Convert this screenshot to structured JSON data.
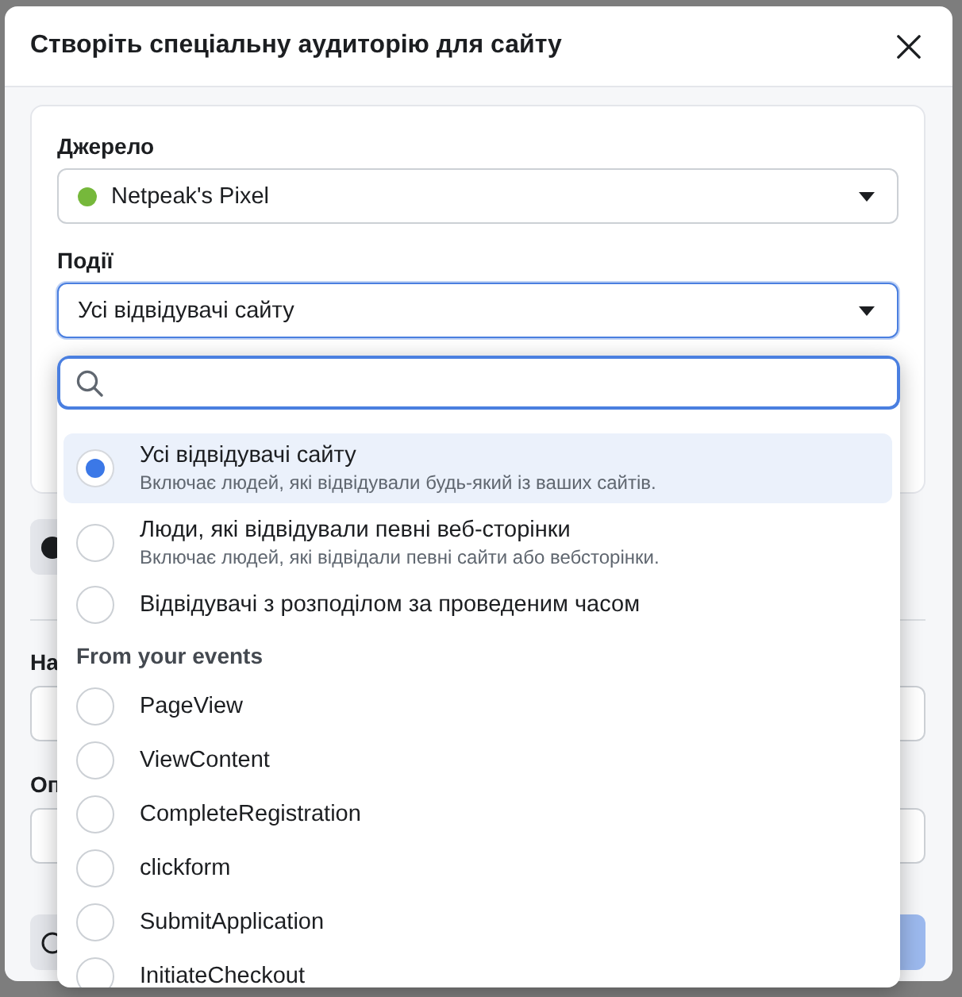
{
  "dialog": {
    "title": "Створіть спеціальну аудиторію для сайту"
  },
  "source": {
    "label": "Джерело",
    "value": "Netpeak's Pixel",
    "active": true
  },
  "events": {
    "label": "Події",
    "value": "Усі відвідувачі сайту",
    "expanded": true,
    "options": [
      {
        "label": "Усі відвідувачі сайту",
        "description": "Включає людей, які відвідували будь-який із ваших сайтів.",
        "selected": true
      },
      {
        "label": "Люди, які відвідували певні веб-сторінки",
        "description": "Включає людей, які відвідали певні сайти або вебсторінки.",
        "selected": false
      },
      {
        "label": "Відвідувачі з розподілом за проведеним часом",
        "selected": false
      }
    ],
    "event_group": {
      "heading": "From your events",
      "options": [
        {
          "label": "PageView",
          "selected": false
        },
        {
          "label": "ViewContent",
          "selected": false
        },
        {
          "label": "CompleteRegistration",
          "selected": false
        },
        {
          "label": "clickform",
          "selected": false
        },
        {
          "label": "SubmitApplication",
          "selected": false
        },
        {
          "label": "InitiateCheckout",
          "selected": false
        }
      ]
    }
  },
  "field_1": {
    "label": "На"
  },
  "field_2": {
    "label": "Оп"
  }
}
